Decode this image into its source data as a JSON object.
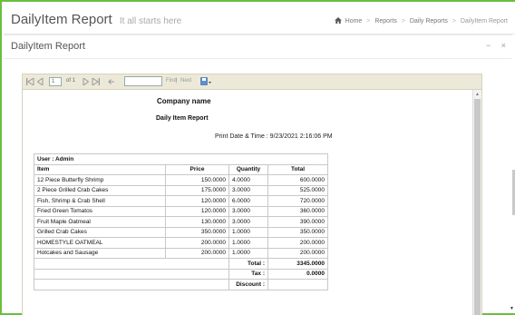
{
  "header": {
    "title": "DailyItem Report",
    "subtitle": "It all starts here",
    "breadcrumb": [
      "Home",
      "Reports",
      "Daily Reports",
      "DailyItem Report"
    ]
  },
  "panel": {
    "title": "DailyItem Report",
    "tools": {
      "collapse": "−",
      "close": "×"
    }
  },
  "viewer": {
    "toolbar": {
      "page_value": "1",
      "page_of": "of 1",
      "find_label": "Find",
      "separator": "|",
      "next_label": "Next"
    },
    "report": {
      "company": "Company name",
      "report_name": "Daily Item Report",
      "print_date": "Print Date & Time : 9/23/2021 2:16:06 PM",
      "user_line": "User : Admin",
      "columns": [
        "Item",
        "Price",
        "Quantity",
        "Total"
      ],
      "rows": [
        [
          "12 Piece Butterfly Shrimp",
          "150.0000",
          "4.0000",
          "600.0000"
        ],
        [
          "2 Piece Grilled Crab Cakes",
          "175.0000",
          "3.0000",
          "525.0000"
        ],
        [
          "Fish, Shrimp & Crab Shell",
          "120.0000",
          "6.0000",
          "720.0000"
        ],
        [
          "Fried Green Tomatos",
          "120.0000",
          "3.0000",
          "360.0000"
        ],
        [
          "Fruit Maple Oatmeal",
          "130.0000",
          "3.0000",
          "390.0000"
        ],
        [
          "Grilled Crab Cakes",
          "350.0000",
          "1.0000",
          "350.0000"
        ],
        [
          "HOMESTYLE OATMEAL",
          "200.0000",
          "1.0000",
          "200.0000"
        ],
        [
          "Hotcakes and Sausage",
          "200.0000",
          "1.0000",
          "200.0000"
        ]
      ],
      "summary": [
        {
          "label": "Total :",
          "value": "3345.0000"
        },
        {
          "label": "Tax :",
          "value": "0.0000"
        },
        {
          "label": "Discount :",
          "value": ""
        }
      ]
    }
  },
  "colors": {
    "frame_border": "#6abf3f",
    "toolbar_bg": "#ece9d8"
  }
}
